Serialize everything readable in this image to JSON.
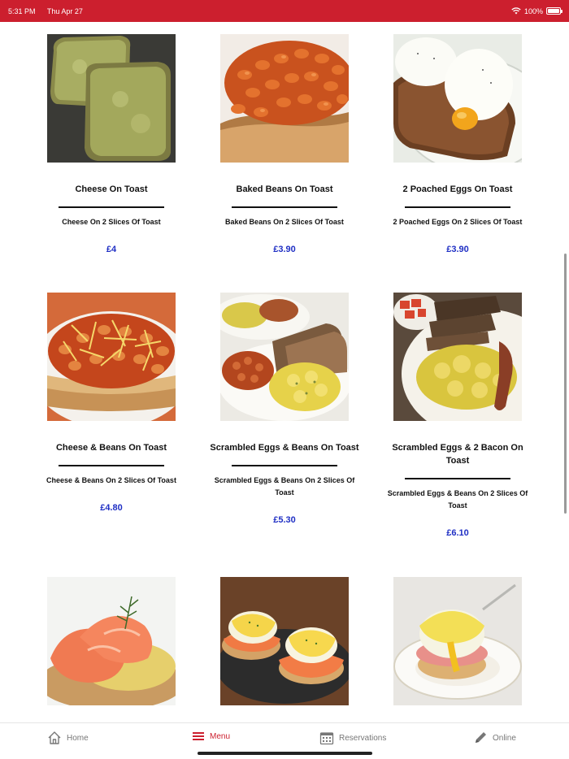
{
  "status_bar": {
    "time": "5:31 PM",
    "date": "Thu Apr 27",
    "battery": "100%"
  },
  "menu": {
    "items": [
      {
        "name": "Cheese On Toast",
        "description": "Cheese On 2 Slices Of Toast",
        "price": "£4"
      },
      {
        "name": "Baked Beans On Toast",
        "description": "Baked Beans On 2 Slices Of Toast",
        "price": "£3.90"
      },
      {
        "name": "2 Poached Eggs On Toast",
        "description": "2 Poached Eggs On 2 Slices Of Toast",
        "price": "£3.90"
      },
      {
        "name": "Cheese & Beans On Toast",
        "description": "Cheese & Beans On 2 Slices Of Toast",
        "price": "£4.80"
      },
      {
        "name": "Scrambled Eggs & Beans On Toast",
        "description": "Scrambled Eggs & Beans On 2 Slices Of Toast",
        "price": "£5.30"
      },
      {
        "name": "Scrambled Eggs & 2 Bacon On Toast",
        "description": "Scrambled Eggs & Beans On 2 Slices Of Toast",
        "price": "£6.10"
      }
    ]
  },
  "tab_bar": {
    "home": "Home",
    "menu": "Menu",
    "reservations": "Reservations",
    "online": "Online"
  },
  "colors": {
    "brand": "#cc1f2e",
    "price": "#1f2fc4"
  }
}
